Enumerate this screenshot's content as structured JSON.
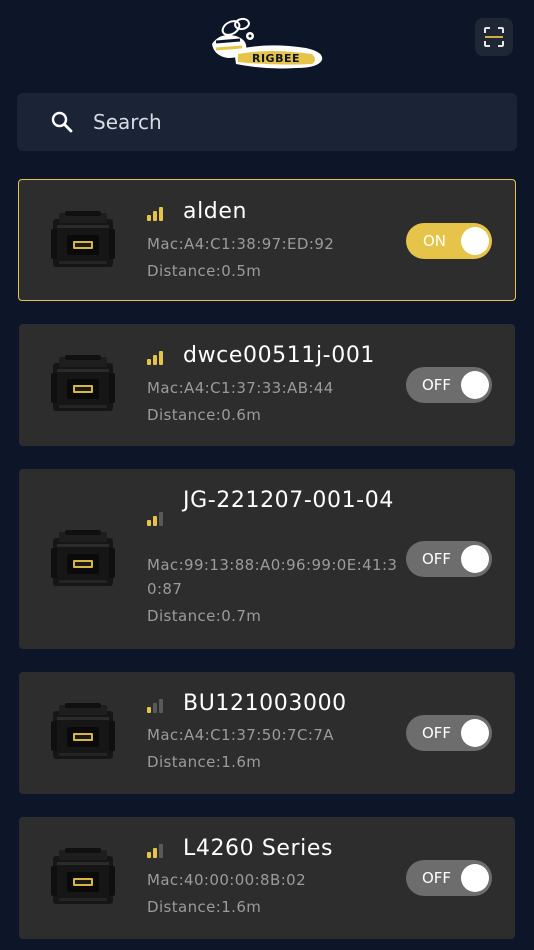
{
  "header": {
    "logo_text": "RIGBEE",
    "scan_icon": "scan-icon"
  },
  "search": {
    "placeholder": "Search",
    "value": "",
    "icon": "search-icon"
  },
  "colors": {
    "background": "#0d1529",
    "card": "#2d2d2d",
    "accent": "#e6c449",
    "toggle_off": "#6d6d6d"
  },
  "devices": [
    {
      "name": "alden",
      "mac": "Mac:A4:C1:38:97:ED:92",
      "distance": "Distance:0.5m",
      "toggle": "ON",
      "signal_bars": 3,
      "selected": true
    },
    {
      "name": "dwce00511j-001",
      "mac": "Mac:A4:C1:37:33:AB:44",
      "distance": "Distance:0.6m",
      "toggle": "OFF",
      "signal_bars": 3,
      "selected": false
    },
    {
      "name": "JG-221207-001-04",
      "mac": "Mac:99:13:88:A0:96:99:0E:41:30:87",
      "distance": "Distance:0.7m",
      "toggle": "OFF",
      "signal_bars": 2,
      "selected": false
    },
    {
      "name": "BU121003000",
      "mac": "Mac:A4:C1:37:50:7C:7A",
      "distance": "Distance:1.6m",
      "toggle": "OFF",
      "signal_bars": 1,
      "selected": false
    },
    {
      "name": "L4260 Series",
      "mac": "Mac:40:00:00:8B:02",
      "distance": "Distance:1.6m",
      "toggle": "OFF",
      "signal_bars": 2,
      "selected": false
    }
  ]
}
